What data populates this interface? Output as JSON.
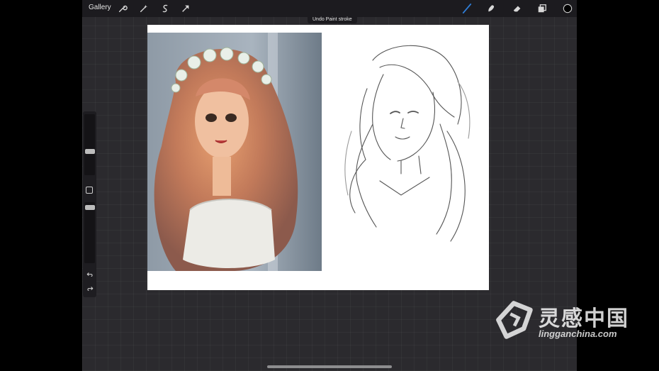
{
  "topbar": {
    "gallery_label": "Gallery",
    "left_tools": [
      "wrench-icon",
      "magic-wand-icon",
      "selection-icon",
      "transform-arrow-icon"
    ],
    "right_tools": [
      "brush-icon",
      "smudge-icon",
      "eraser-icon",
      "layers-icon",
      "color-swatch"
    ],
    "brush_active_color": "#2f7dd6",
    "current_color": "#000000"
  },
  "toast": {
    "text": "Undo Paint stroke"
  },
  "sidebar": {
    "brush_size": 0.62,
    "opacity": 0.92,
    "undo_icon": "undo-icon",
    "redo_icon": "redo-icon"
  },
  "canvas": {
    "background": "#ffffff",
    "reference_image": "doll with flower crown photo",
    "sketch": "line drawing of woman with long wavy hair"
  },
  "watermark": {
    "text": "灵感中国",
    "url": "lingganchina.com"
  }
}
